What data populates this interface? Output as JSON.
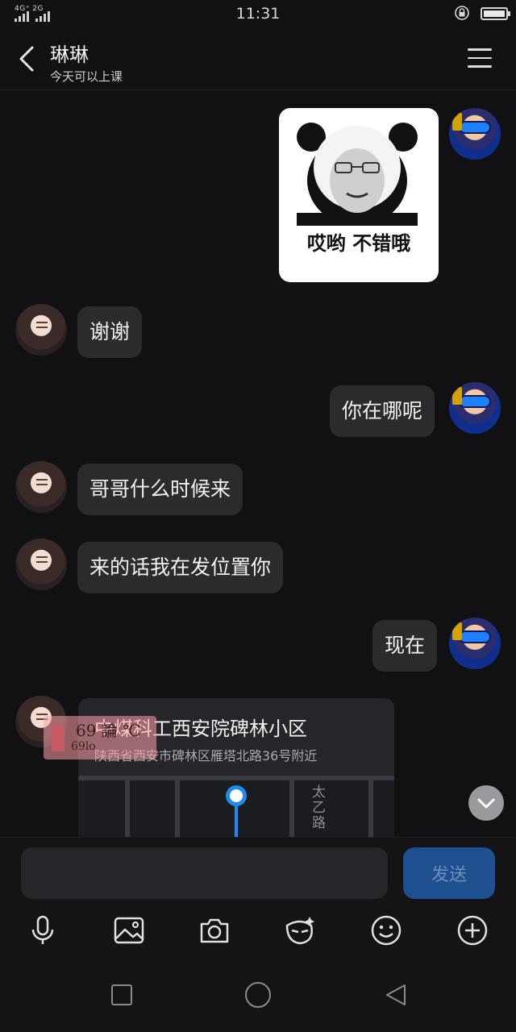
{
  "status_bar": {
    "network": "4G⁺ 2G",
    "time": "11:31"
  },
  "header": {
    "title": "琳琳",
    "subtitle": "今天可以上课"
  },
  "messages": {
    "sticker_caption": "哎哟 不错哦",
    "m1": "谢谢",
    "m2": "你在哪呢",
    "m3": "哥哥什么时候来",
    "m4": "来的话我在发位置你",
    "m5": "现在"
  },
  "location": {
    "name": "中煤科工西安院碑林小区",
    "address": "陕西省西安市碑林区雁塔北路36号附近",
    "street_label": "太乙路"
  },
  "watermark": {
    "line1": "69 論 ℃",
    "line2": "69lo"
  },
  "input": {
    "value": "",
    "send_label": "发送"
  }
}
